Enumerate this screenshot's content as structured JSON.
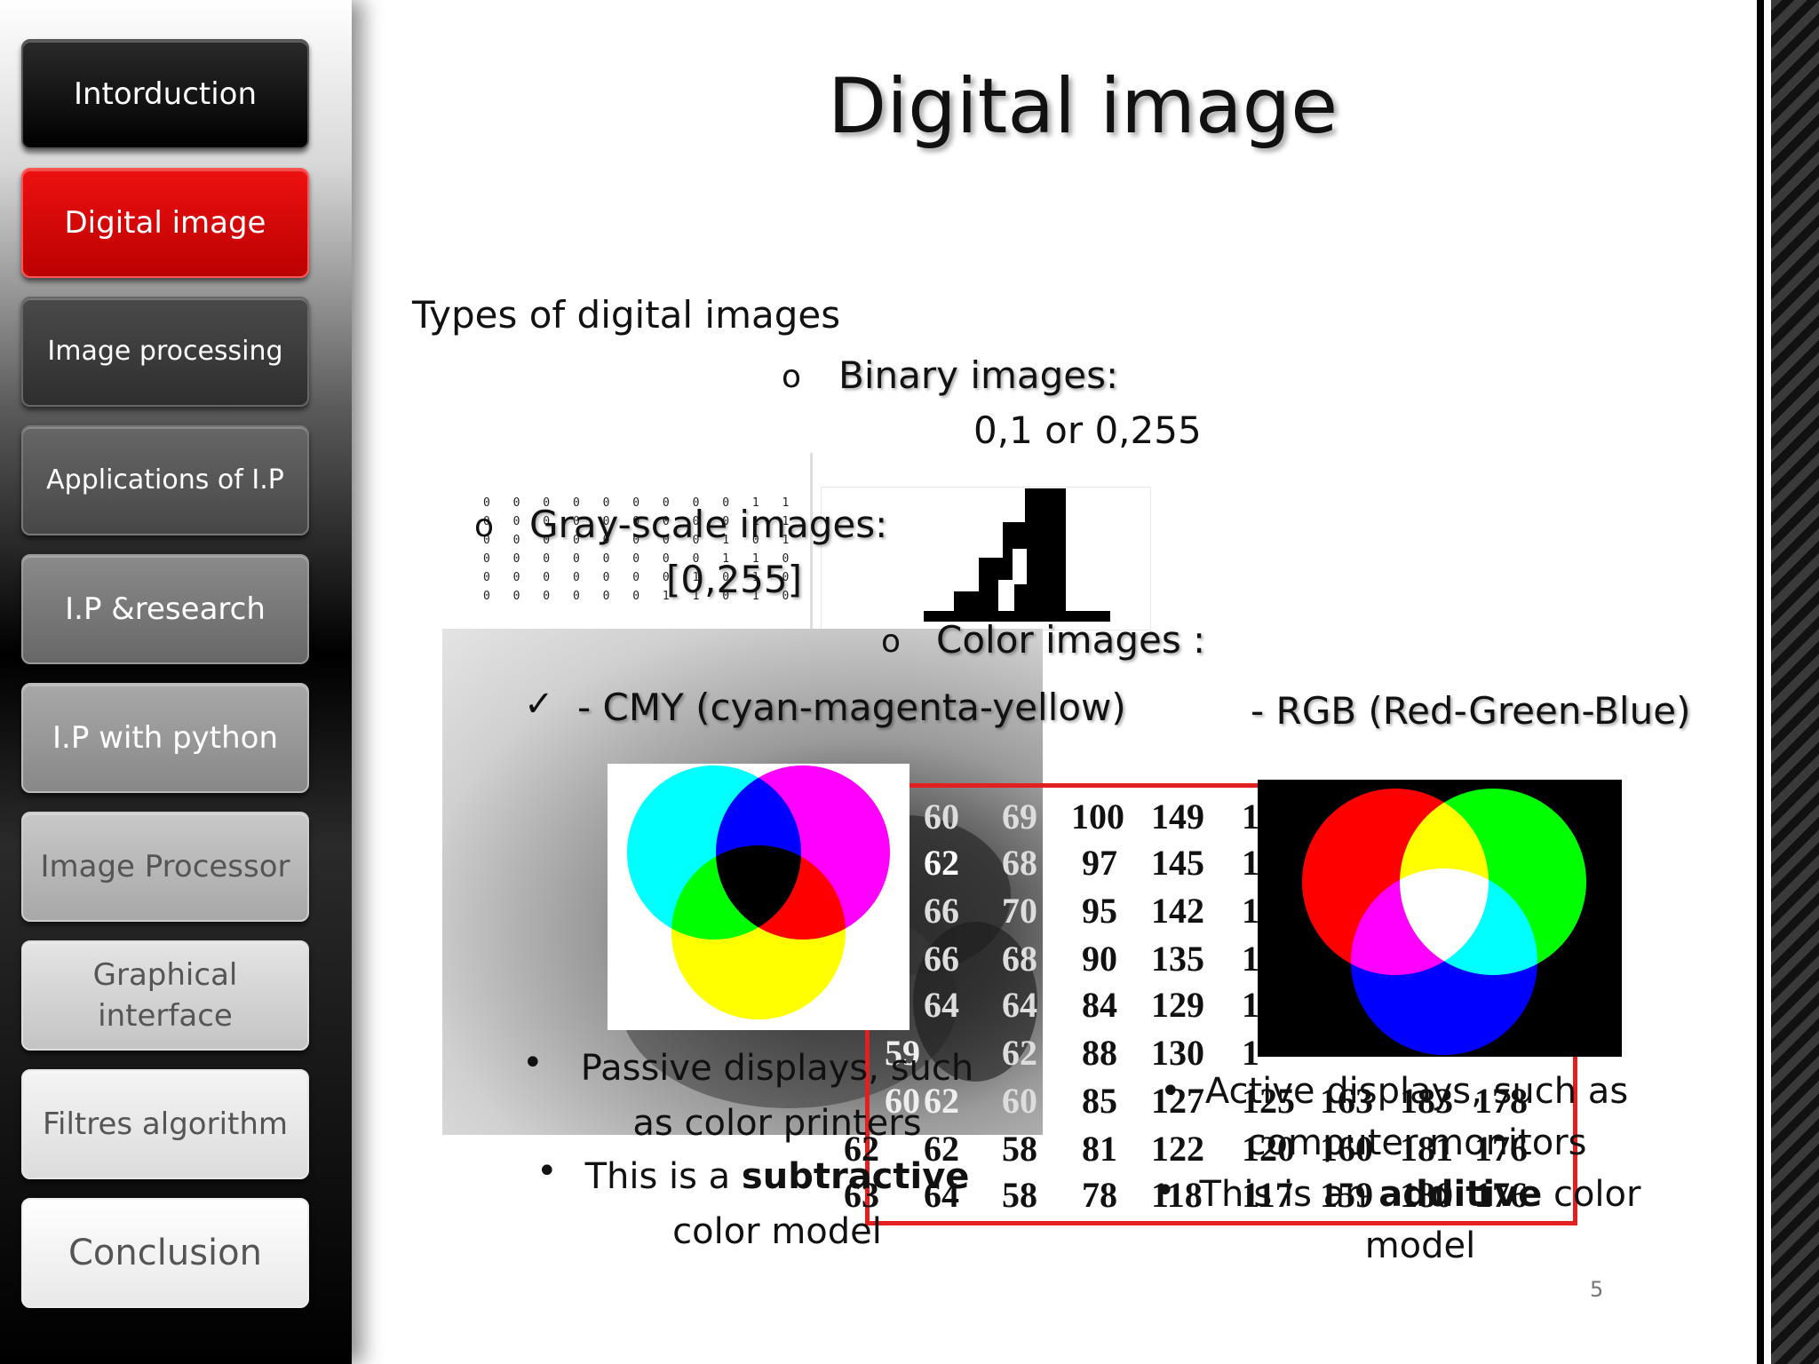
{
  "sidebar": {
    "items": [
      {
        "label": "Intorduction"
      },
      {
        "label": "Digital image"
      },
      {
        "label": "Image processing"
      },
      {
        "label": "Applications of I.P"
      },
      {
        "label": "I.P &research"
      },
      {
        "label": "I.P with python"
      },
      {
        "label": "Image Processor"
      },
      {
        "label": "Graphical interface"
      },
      {
        "label": "Filtres algorithm"
      },
      {
        "label": "Conclusion"
      }
    ]
  },
  "slide": {
    "title": "Digital image",
    "subtitle": "Types  of digital images",
    "binary": {
      "bullet": "o",
      "label": "Binary images:",
      "range": "0,1 or 0,255"
    },
    "grayscale": {
      "bullet": "o",
      "label": "Gray-scale images:",
      "range": "[0,255]"
    },
    "color": {
      "bullet": "o",
      "label": "Color images :"
    },
    "cmy": {
      "check": "✓",
      "label": "- CMY (cyan-magenta-yellow)",
      "bullet1": "Passive displays, such as color printers",
      "bullet2_pre": "This is a ",
      "bullet2_bold": "subtractive",
      "bullet2_post": " color model"
    },
    "rgb": {
      "label": "- RGB (Red-Green-Blue)",
      "bullet1": "Active displays, such as computer monitors",
      "bullet2_pre": "This is an ",
      "bullet2_bold": "additive",
      "bullet2_post": " color model"
    },
    "binary_matrix": "0 0 0 0 0 0 0 0 0 1 1 0 0 0 0\n0 0 0 0 0 0 0 0 0 1 1 0 0 0 0\n0 0 0 0 0 0 0 0 1 0 1 0 0 0 0\n0 0 0 0 0 0 0 0 1 1 0 1 0 0 0\n0 0 0 0 0 0 0 1 0 1 0 0 0 0 0\n0 0 0 0 0 0 1 1 0 1 0 0 0 0 0",
    "gray_values": [
      [
        "60",
        "69",
        "100",
        "149",
        "1"
      ],
      [
        "62",
        "68",
        "97",
        "145",
        "1"
      ],
      [
        "66",
        "70",
        "95",
        "142",
        "1"
      ],
      [
        "66",
        "68",
        "90",
        "135",
        "1"
      ],
      [
        "64",
        "64",
        "84",
        "129",
        "1"
      ],
      [
        "59",
        "62",
        "88",
        "130",
        "1"
      ],
      [
        "60",
        "62",
        "60",
        "85",
        "127",
        "125",
        "163",
        "183",
        "178"
      ],
      [
        "62",
        "62",
        "58",
        "81",
        "122",
        "120",
        "160",
        "181",
        "176"
      ],
      [
        "63",
        "64",
        "58",
        "78",
        "118",
        "117",
        "159",
        "180",
        "176"
      ]
    ],
    "page_number": "5"
  },
  "colors": {
    "active_tab": "#cc0000",
    "cyan": "#00ffff",
    "magenta": "#ff00ff",
    "yellow": "#ffff00",
    "red": "#ff0000",
    "green": "#00ff00",
    "blue": "#0000ff"
  }
}
